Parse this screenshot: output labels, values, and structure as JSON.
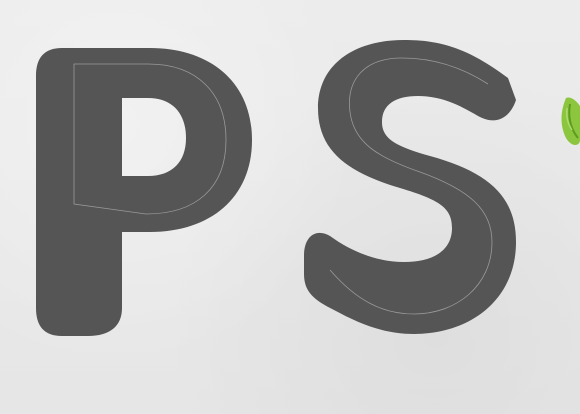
{
  "logo": {
    "text": "PS",
    "letter_p": "P",
    "letter_s": "S"
  },
  "colors": {
    "background": "#e9e9e9",
    "letter_fill": "#555555",
    "stroke_highlight": "#9a9a9a",
    "leaf_green": "#8cc63f",
    "leaf_dark": "#5e9c1f"
  },
  "icons": {
    "leaf": "green-leaf-icon"
  }
}
